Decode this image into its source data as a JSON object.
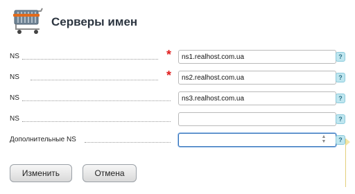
{
  "header": {
    "title": "Серверы имен",
    "icon": "shopping-cart-icon"
  },
  "fields": [
    {
      "label": "NS",
      "required": true,
      "value": "ns1.realhost.com.ua"
    },
    {
      "label": "NS",
      "required": true,
      "value": "ns2.realhost.com.ua"
    },
    {
      "label": "NS",
      "required": false,
      "value": "ns3.realhost.com.ua"
    },
    {
      "label": "NS",
      "required": false,
      "value": ""
    },
    {
      "label": "Дополнительные NS",
      "required": false,
      "value": ""
    }
  ],
  "required_mark": "*",
  "help_mark": "?",
  "buttons": {
    "change": "Изменить",
    "cancel": "Отмена"
  },
  "colors": {
    "required": "#e02020",
    "help_bg": "#bfe6ef",
    "focus_border": "#2e6fb8"
  }
}
